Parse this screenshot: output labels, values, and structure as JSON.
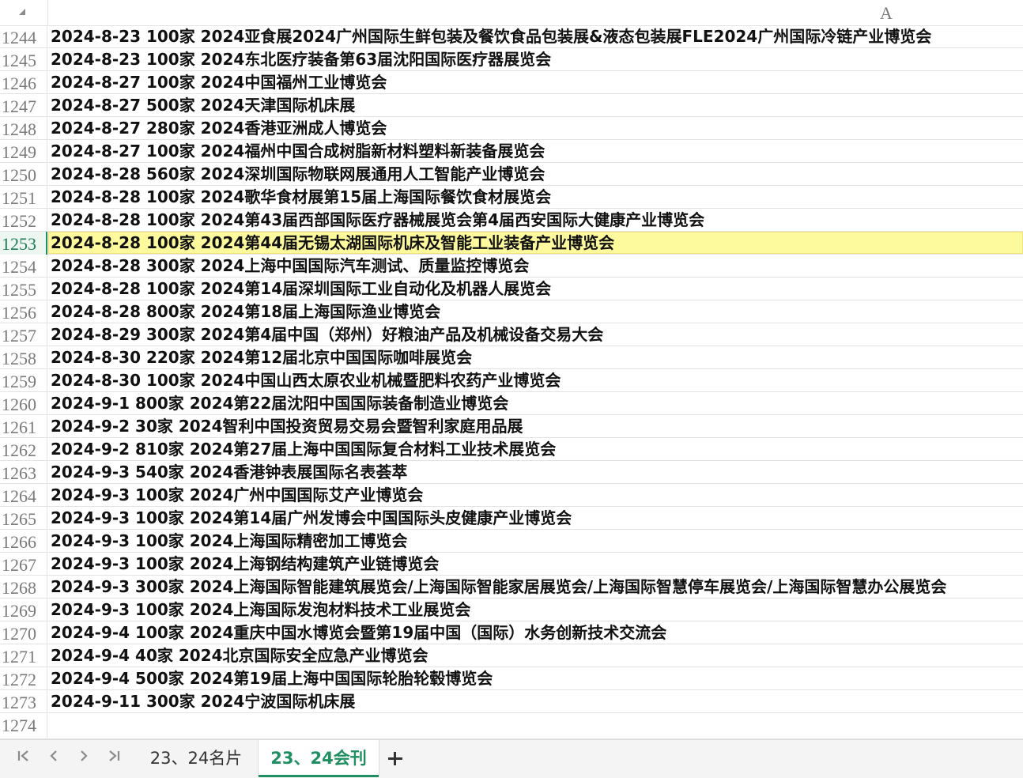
{
  "column_header": {
    "label": "A"
  },
  "rows": [
    {
      "num": "1244",
      "text": "2024-8-23 100家 2024亚食展2024广州国际生鲜包装及餐饮食品包装展&液态包装展FLE2024广州国际冷链产业博览会"
    },
    {
      "num": "1245",
      "text": "2024-8-23 100家 2024东北医疗装备第63届沈阳国际医疗器展览会"
    },
    {
      "num": "1246",
      "text": "2024-8-27 100家 2024中国福州工业博览会"
    },
    {
      "num": "1247",
      "text": "2024-8-27 500家 2024天津国际机床展"
    },
    {
      "num": "1248",
      "text": "2024-8-27 280家 2024香港亚洲成人博览会"
    },
    {
      "num": "1249",
      "text": "2024-8-27 100家 2024福州中国合成树脂新材料塑料新装备展览会"
    },
    {
      "num": "1250",
      "text": "2024-8-28 560家 2024深圳国际物联网展通用人工智能产业博览会"
    },
    {
      "num": "1251",
      "text": "2024-8-28 100家 2024歌华食材展第15届上海国际餐饮食材展览会"
    },
    {
      "num": "1252",
      "text": "2024-8-28 100家 2024第43届西部国际医疗器械展览会第4届西安国际大健康产业博览会"
    },
    {
      "num": "1253",
      "text": "2024-8-28 100家 2024第44届无锡太湖国际机床及智能工业装备产业博览会"
    },
    {
      "num": "1254",
      "text": "2024-8-28 300家 2024上海中国国际汽车测试、质量监控博览会"
    },
    {
      "num": "1255",
      "text": "2024-8-28 100家 2024第14届深圳国际工业自动化及机器人展览会"
    },
    {
      "num": "1256",
      "text": "2024-8-28 800家 2024第18届上海国际渔业博览会"
    },
    {
      "num": "1257",
      "text": "2024-8-29 300家 2024第4届中国（郑州）好粮油产品及机械设备交易大会"
    },
    {
      "num": "1258",
      "text": "2024-8-30 220家 2024第12届北京中国国际咖啡展览会"
    },
    {
      "num": "1259",
      "text": "2024-8-30 100家 2024中国山西太原农业机械暨肥料农药产业博览会"
    },
    {
      "num": "1260",
      "text": "2024-9-1 800家 2024第22届沈阳中国国际装备制造业博览会"
    },
    {
      "num": "1261",
      "text": "2024-9-2 30家 2024智利中国投资贸易交易会暨智利家庭用品展"
    },
    {
      "num": "1262",
      "text": "2024-9-2 810家 2024第27届上海中国国际复合材料工业技术展览会"
    },
    {
      "num": "1263",
      "text": "2024-9-3 540家 2024香港钟表展国际名表荟萃"
    },
    {
      "num": "1264",
      "text": "2024-9-3 100家 2024广州中国国际艾产业博览会"
    },
    {
      "num": "1265",
      "text": "2024-9-3 100家 2024第14届广州发博会中国国际头皮健康产业博览会"
    },
    {
      "num": "1266",
      "text": "2024-9-3 100家 2024上海国际精密加工博览会"
    },
    {
      "num": "1267",
      "text": "2024-9-3 100家 2024上海钢结构建筑产业链博览会"
    },
    {
      "num": "1268",
      "text": "2024-9-3 300家 2024上海国际智能建筑展览会/上海国际智能家居展览会/上海国际智慧停车展览会/上海国际智慧办公展览会"
    },
    {
      "num": "1269",
      "text": "2024-9-3 100家 2024上海国际发泡材料技术工业展览会"
    },
    {
      "num": "1270",
      "text": "2024-9-4 100家 2024重庆中国水博览会暨第19届中国（国际）水务创新技术交流会"
    },
    {
      "num": "1271",
      "text": "2024-9-4 40家 2024北京国际安全应急产业博览会"
    },
    {
      "num": "1272",
      "text": "2024-9-4 500家 2024第19届上海中国国际轮胎轮毂博览会"
    },
    {
      "num": "1273",
      "text": "2024-9-11 300家 2024宁波国际机床展"
    },
    {
      "num": "1274",
      "text": ""
    }
  ],
  "selected_row": "1253",
  "tabs": {
    "nav": {
      "first": "|<",
      "prev": "<",
      "next": ">",
      "last": ">|"
    },
    "items": [
      {
        "label": "23、24名片"
      },
      {
        "label": "23、24会刊"
      }
    ],
    "active_index": 1
  },
  "colors": {
    "selected_fill": "#fdfa9e",
    "active_tab": "#1f8f62"
  }
}
